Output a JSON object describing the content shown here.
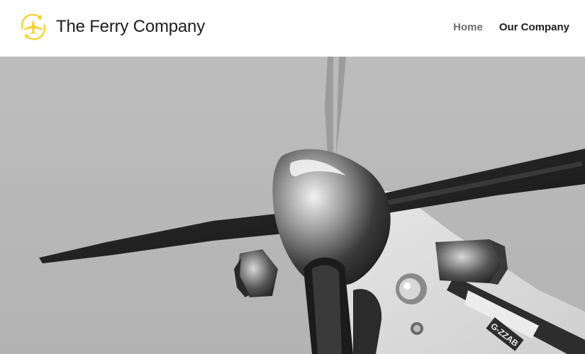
{
  "header": {
    "site_title": "The Ferry Company",
    "logo_icon": "plane-circular-arrows-icon",
    "logo_color": "#f2d33c"
  },
  "nav": {
    "items": [
      {
        "label": "Home",
        "active": true
      },
      {
        "label": "Our Company",
        "active": false
      }
    ]
  },
  "hero": {
    "image": "grayscale-propeller-aircraft-nose-photo",
    "aircraft_marking": "G-ZZAB"
  }
}
